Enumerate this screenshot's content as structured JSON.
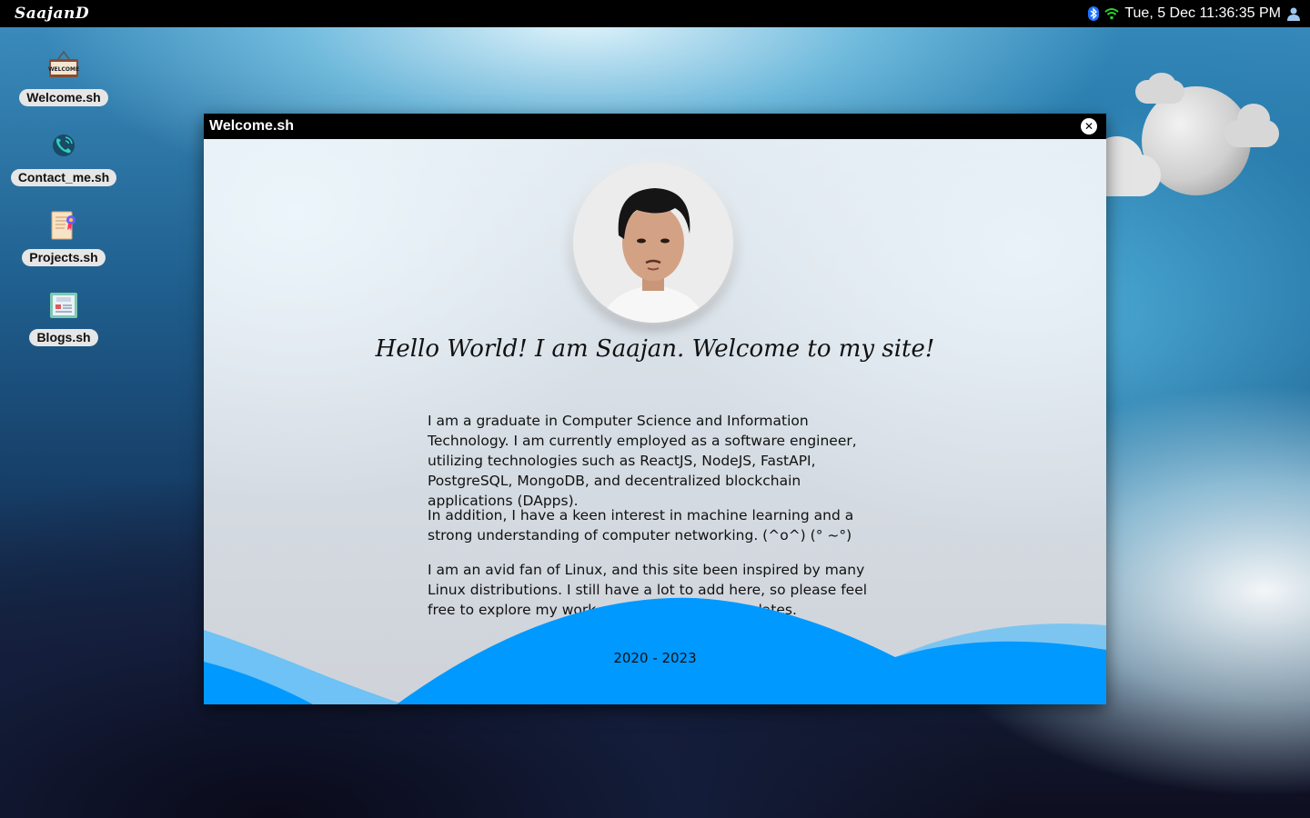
{
  "topbar": {
    "brand": "SaajanD",
    "clock": "Tue, 5 Dec 11:36:35 PM",
    "icons": [
      "bluetooth-icon",
      "wifi-icon",
      "user-icon"
    ]
  },
  "desktop": {
    "icons": [
      {
        "label": "Welcome.sh",
        "icon": "welcome-sign-icon"
      },
      {
        "label": "Contact_me.sh",
        "icon": "phone-icon"
      },
      {
        "label": "Projects.sh",
        "icon": "certificate-icon"
      },
      {
        "label": "Blogs.sh",
        "icon": "blog-icon"
      }
    ]
  },
  "window": {
    "title": "Welcome.sh",
    "close_icon": "close-icon",
    "headline": "Hello World! I am Saajan. Welcome to my site!",
    "paragraphs": [
      "I am a graduate in Computer Science and Information Technology. I am currently employed as a software engineer, utilizing technologies such as ReactJS, NodeJS, FastAPI, PostgreSQL, MongoDB, and decentralized blockchain applications (DApps).",
      "In addition, I have a keen interest in machine learning and a strong understanding of computer networking. (^o^) (° ~°)",
      "I am an avid fan of Linux, and this site been inspired by many Linux distributions. I still have a lot to add here, so please feel free to explore my work and stay tuned for updates."
    ],
    "years": "2020 - 2023"
  },
  "colors": {
    "wave_primary": "#0099ff",
    "wave_light": "#6ec2f5",
    "topbar_bg": "#000000"
  }
}
